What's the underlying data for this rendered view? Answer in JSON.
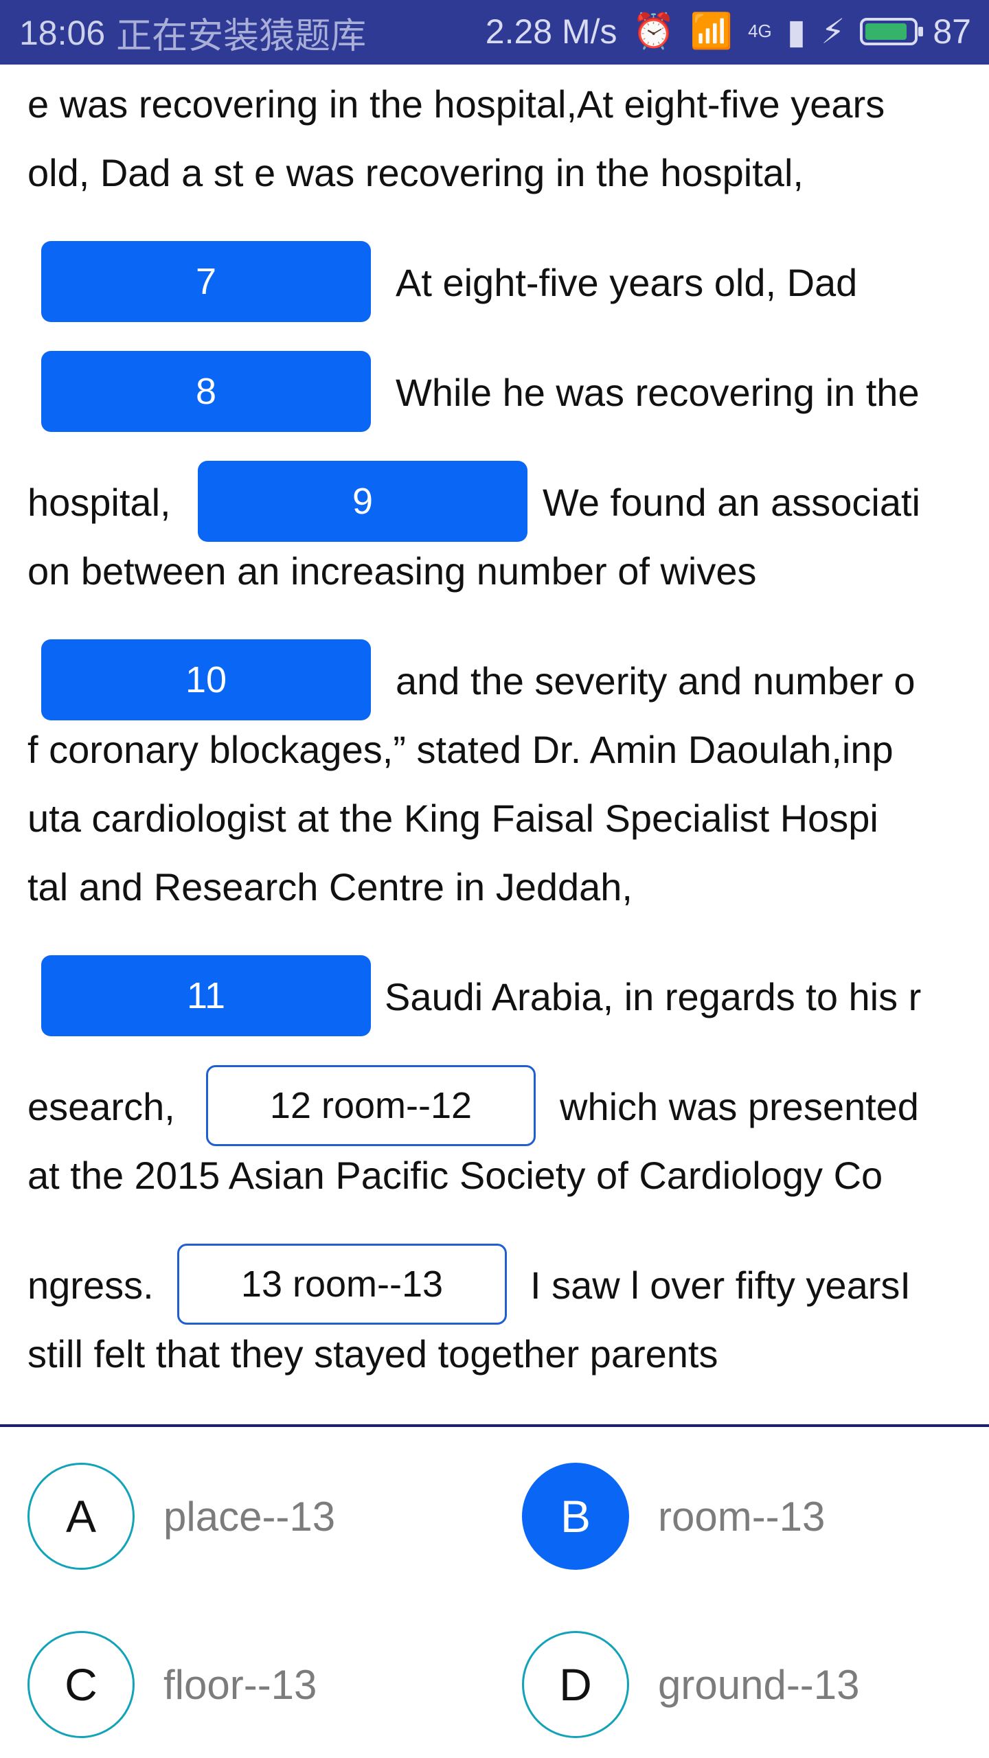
{
  "status_bar": {
    "time": "18:06",
    "notification": "正在安装猿题库",
    "network_speed": "2.28 M/s",
    "signal_label": "4G",
    "battery_level": "87"
  },
  "passage": {
    "lines": [
      "e was recovering in the hospital,At eight-five years",
      "old, Dad a st e was recovering in the hospital,",
      "At eight-five years old, Dad",
      "While he was recovering in the",
      "hospital,",
      "We found an associati",
      "on between an increasing number of wives",
      "and the severity and number o",
      "f coronary blockages,” stated Dr. Amin Daoulah,inp",
      "uta cardiologist at the King Faisal Specialist Hospi",
      "tal and Research Centre in Jeddah,",
      "Saudi Arabia, in regards to his r",
      "esearch,",
      "which was presented",
      "at the 2015 Asian Pacific Society of Cardiology Co",
      "ngress.",
      "I saw l over fifty yearsI",
      "still felt that they stayed together parents"
    ],
    "blanks": [
      {
        "label": "7"
      },
      {
        "label": "8"
      },
      {
        "label": "9"
      },
      {
        "label": "10"
      },
      {
        "label": "11"
      },
      {
        "label": "12 room--12"
      },
      {
        "label": "13 room--13"
      }
    ]
  },
  "options": [
    {
      "letter": "A",
      "text": "place--13",
      "selected": false
    },
    {
      "letter": "B",
      "text": "room--13",
      "selected": true
    },
    {
      "letter": "C",
      "text": "floor--13",
      "selected": false
    },
    {
      "letter": "D",
      "text": "ground--13",
      "selected": false
    }
  ],
  "colors": {
    "status_bar": "#2f3a94",
    "blank_fill": "#0a66f5",
    "option_ring": "#13a3b8",
    "divider": "#1c1f6e"
  }
}
